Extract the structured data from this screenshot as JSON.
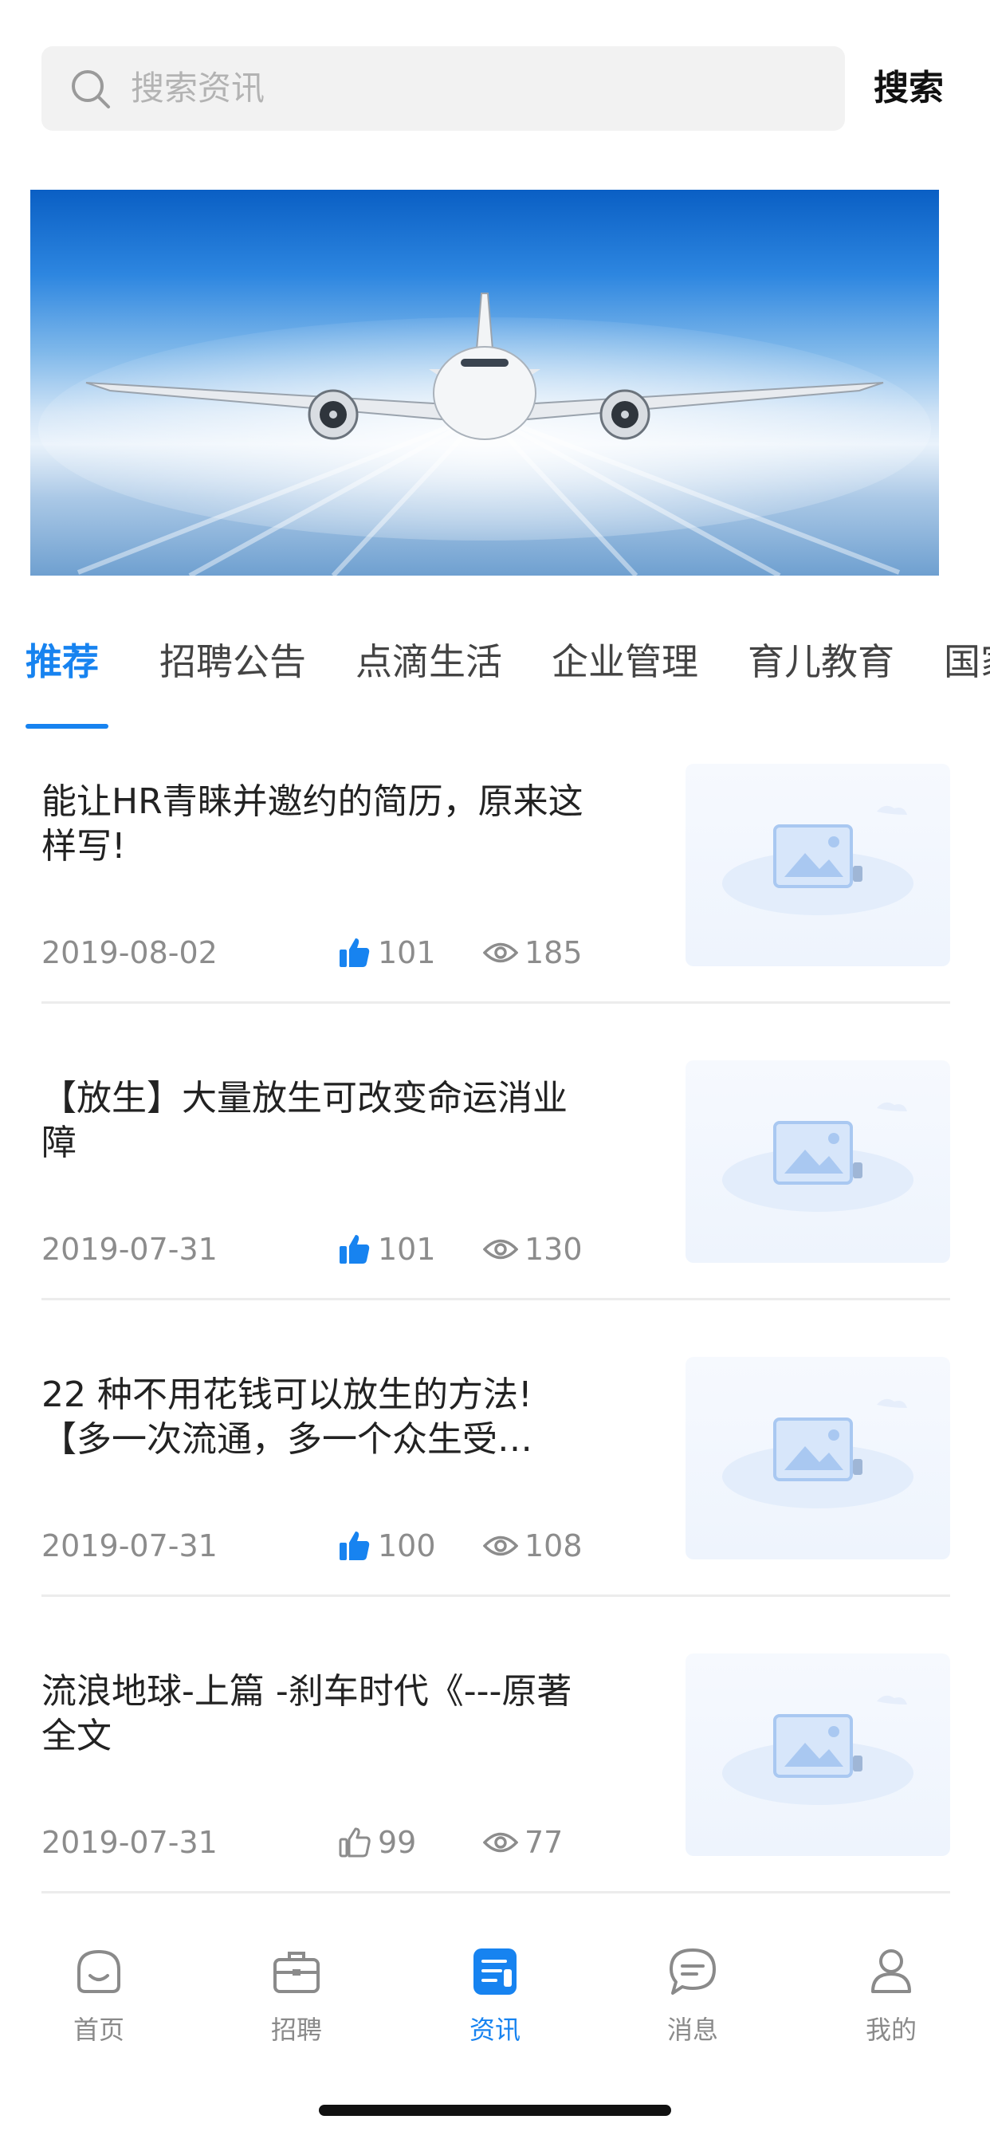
{
  "search": {
    "placeholder": "搜索资讯",
    "button_label": "搜索",
    "icon": "search-icon"
  },
  "banner": {
    "image": "airplane flying above clouds",
    "colors": {
      "sky": "#2d86e0",
      "clouds": "#e9f2fb"
    }
  },
  "tabs": [
    {
      "label": "推荐",
      "active": true
    },
    {
      "label": "招聘公告",
      "active": false
    },
    {
      "label": "点滴生活",
      "active": false
    },
    {
      "label": "企业管理",
      "active": false
    },
    {
      "label": "育儿教育",
      "active": false
    },
    {
      "label": "国家",
      "active": false
    }
  ],
  "articles": [
    {
      "title": "能让HR青睐并邀约的简历，原来这样写!",
      "date": "2019-08-02",
      "likes": "101",
      "views": "185",
      "liked": true
    },
    {
      "title": "【放生】大量放生可改变命运消业障",
      "date": "2019-07-31",
      "likes": "101",
      "views": "130",
      "liked": true
    },
    {
      "title": "22 种不用花钱可以放生的方法!【多一次流通，多一个众生受…",
      "date": "2019-07-31",
      "likes": "100",
      "views": "108",
      "liked": true
    },
    {
      "title": "流浪地球-上篇 -刹车时代《---原著全文",
      "date": "2019-07-31",
      "likes": "99",
      "views": "77",
      "liked": false
    }
  ],
  "tabbar": [
    {
      "label": "首页",
      "icon": "home-icon",
      "active": false
    },
    {
      "label": "招聘",
      "icon": "briefcase-icon",
      "active": false
    },
    {
      "label": "资讯",
      "icon": "news-icon",
      "active": true
    },
    {
      "label": "消息",
      "icon": "message-icon",
      "active": false
    },
    {
      "label": "我的",
      "icon": "profile-icon",
      "active": false
    }
  ],
  "colors": {
    "accent": "#1783f0",
    "muted": "#8c8c8c",
    "divider": "#ececec"
  }
}
